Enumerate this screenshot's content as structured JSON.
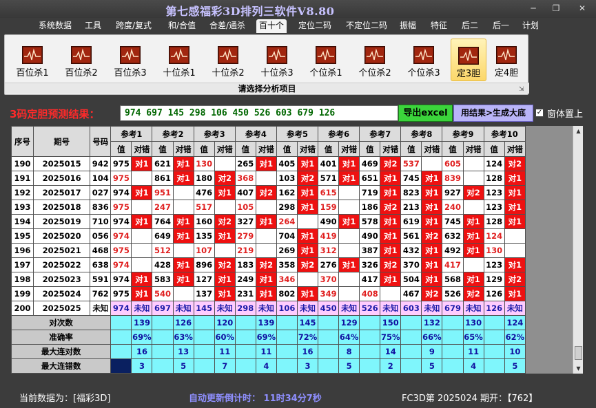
{
  "window": {
    "title": "第七感福彩3D排列三软件V8.80",
    "controls": [
      "minimize-icon",
      "restore-icon",
      "close-icon"
    ]
  },
  "menu": [
    "系统数据",
    "工具",
    "跨度/复式",
    "和/合值",
    "合差/通杀",
    "百十个",
    "定位二码",
    "不定位二码",
    "振幅",
    "特征",
    "后二",
    "后一",
    "计划"
  ],
  "menu_active": "百十个",
  "ribbon": {
    "buttons": [
      "百位杀1",
      "百位杀2",
      "百位杀3",
      "十位杀1",
      "十位杀2",
      "十位杀3",
      "个位杀1",
      "个位杀2",
      "个位杀3",
      "定3胆",
      "定4胆"
    ],
    "active": "定3胆",
    "icon": "chart-icon",
    "caption": "请选择分析项目"
  },
  "result": {
    "label": "3码定胆预测结果：",
    "value": "974 697 145 298 106 450 526 603 679 126",
    "export_label": "导出excel",
    "generate_label": "用结果>生成大底",
    "ontop_checked": true,
    "ontop_label": "窗体置上"
  },
  "table": {
    "headers": {
      "seq": "序号",
      "period": "期号",
      "code": "号码",
      "value": "值",
      "mark": "对错"
    },
    "refs": [
      "参考1",
      "参考2",
      "参考3",
      "参考4",
      "参考5",
      "参考6",
      "参考7",
      "参考8",
      "参考9",
      "参考10"
    ],
    "rows": [
      {
        "seq": "190",
        "period": "2025015",
        "code": "942",
        "cells": [
          [
            "975",
            "对1"
          ],
          [
            "621",
            "对1"
          ],
          [
            "130",
            ""
          ],
          [
            "265",
            "对1"
          ],
          [
            "405",
            "对1"
          ],
          [
            "401",
            "对1"
          ],
          [
            "469",
            "对2"
          ],
          [
            "537",
            ""
          ],
          [
            "605",
            ""
          ],
          [
            "124",
            "对2"
          ]
        ]
      },
      {
        "seq": "191",
        "period": "2025016",
        "code": "104",
        "cells": [
          [
            "975",
            ""
          ],
          [
            "861",
            "对1"
          ],
          [
            "180",
            "对2"
          ],
          [
            "368",
            ""
          ],
          [
            "103",
            "对2"
          ],
          [
            "571",
            "对1"
          ],
          [
            "651",
            "对1"
          ],
          [
            "745",
            "对1"
          ],
          [
            "839",
            ""
          ],
          [
            "128",
            "对1"
          ]
        ]
      },
      {
        "seq": "192",
        "period": "2025017",
        "code": "027",
        "cells": [
          [
            "974",
            "对1"
          ],
          [
            "951",
            ""
          ],
          [
            "476",
            "对1"
          ],
          [
            "407",
            "对2"
          ],
          [
            "162",
            "对1"
          ],
          [
            "615",
            ""
          ],
          [
            "719",
            "对1"
          ],
          [
            "823",
            "对1"
          ],
          [
            "927",
            "对2"
          ],
          [
            "123",
            "对1"
          ]
        ]
      },
      {
        "seq": "193",
        "period": "2025018",
        "code": "836",
        "cells": [
          [
            "975",
            ""
          ],
          [
            "247",
            ""
          ],
          [
            "517",
            ""
          ],
          [
            "105",
            ""
          ],
          [
            "298",
            "对1"
          ],
          [
            "159",
            ""
          ],
          [
            "186",
            "对2"
          ],
          [
            "213",
            "对1"
          ],
          [
            "240",
            ""
          ],
          [
            "123",
            "对1"
          ]
        ]
      },
      {
        "seq": "194",
        "period": "2025019",
        "code": "710",
        "cells": [
          [
            "974",
            "对1"
          ],
          [
            "764",
            "对1"
          ],
          [
            "160",
            "对2"
          ],
          [
            "327",
            "对1"
          ],
          [
            "264",
            ""
          ],
          [
            "490",
            "对1"
          ],
          [
            "578",
            "对1"
          ],
          [
            "619",
            "对1"
          ],
          [
            "745",
            "对1"
          ],
          [
            "128",
            "对1"
          ]
        ]
      },
      {
        "seq": "195",
        "period": "2025020",
        "code": "056",
        "cells": [
          [
            "974",
            ""
          ],
          [
            "649",
            "对1"
          ],
          [
            "135",
            "对1"
          ],
          [
            "279",
            ""
          ],
          [
            "704",
            "对1"
          ],
          [
            "419",
            ""
          ],
          [
            "490",
            "对1"
          ],
          [
            "561",
            "对2"
          ],
          [
            "632",
            "对1"
          ],
          [
            "124",
            ""
          ]
        ]
      },
      {
        "seq": "196",
        "period": "2025021",
        "code": "468",
        "cells": [
          [
            "975",
            ""
          ],
          [
            "512",
            ""
          ],
          [
            "107",
            ""
          ],
          [
            "219",
            ""
          ],
          [
            "269",
            "对1"
          ],
          [
            "312",
            ""
          ],
          [
            "387",
            "对1"
          ],
          [
            "432",
            "对1"
          ],
          [
            "492",
            "对1"
          ],
          [
            "130",
            ""
          ]
        ]
      },
      {
        "seq": "197",
        "period": "2025022",
        "code": "638",
        "cells": [
          [
            "974",
            ""
          ],
          [
            "428",
            "对1"
          ],
          [
            "896",
            "对2"
          ],
          [
            "183",
            "对2"
          ],
          [
            "358",
            "对2"
          ],
          [
            "276",
            "对1"
          ],
          [
            "326",
            "对2"
          ],
          [
            "370",
            "对1"
          ],
          [
            "417",
            ""
          ],
          [
            "123",
            "对1"
          ]
        ]
      },
      {
        "seq": "198",
        "period": "2025023",
        "code": "591",
        "cells": [
          [
            "974",
            "对1"
          ],
          [
            "583",
            "对1"
          ],
          [
            "127",
            "对1"
          ],
          [
            "249",
            "对1"
          ],
          [
            "346",
            ""
          ],
          [
            "370",
            ""
          ],
          [
            "417",
            "对1"
          ],
          [
            "504",
            "对1"
          ],
          [
            "568",
            "对1"
          ],
          [
            "129",
            "对2"
          ]
        ]
      },
      {
        "seq": "199",
        "period": "2025024",
        "code": "762",
        "cells": [
          [
            "975",
            "对1"
          ],
          [
            "540",
            ""
          ],
          [
            "137",
            "对1"
          ],
          [
            "231",
            "对1"
          ],
          [
            "802",
            "对1"
          ],
          [
            "349",
            ""
          ],
          [
            "408",
            ""
          ],
          [
            "467",
            "对2"
          ],
          [
            "526",
            "对2"
          ],
          [
            "126",
            "对1"
          ]
        ]
      }
    ],
    "future_row": {
      "seq": "200",
      "period": "2025025",
      "code": "未知",
      "values": [
        "974",
        "697",
        "145",
        "298",
        "106",
        "450",
        "526",
        "603",
        "679",
        "126"
      ],
      "mark": "未知"
    },
    "stats": [
      {
        "label": "对次数",
        "values": [
          "139",
          "126",
          "120",
          "139",
          "145",
          "129",
          "150",
          "132",
          "130",
          "124"
        ]
      },
      {
        "label": "准确率",
        "values": [
          "69%",
          "63%",
          "60%",
          "69%",
          "72%",
          "64%",
          "75%",
          "66%",
          "65%",
          "62%"
        ]
      },
      {
        "label": "最大连对数",
        "values": [
          "16",
          "13",
          "11",
          "11",
          "16",
          "8",
          "14",
          "9",
          "11",
          "10"
        ]
      },
      {
        "label": "最大连错数",
        "values": [
          "3",
          "5",
          "7",
          "4",
          "3",
          "5",
          "2",
          "5",
          "4",
          "5"
        ]
      }
    ]
  },
  "status": {
    "current": "当前数据为：[福彩3D]",
    "timer": "自动更新倒计时：  11时34分7秒",
    "issue": "FC3D第 2025024 期开：【762】"
  }
}
